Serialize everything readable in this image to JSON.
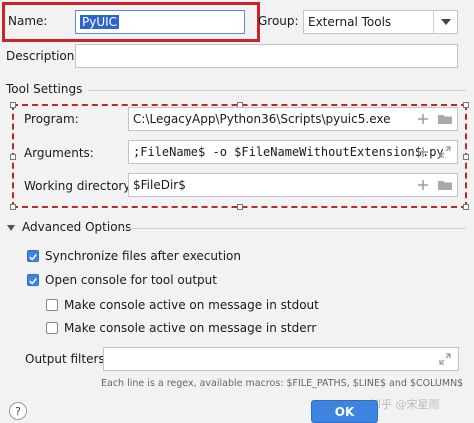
{
  "name": {
    "label": "Name:",
    "value": "PyUIC"
  },
  "group": {
    "label": "Group:",
    "value": "External Tools"
  },
  "description": {
    "label": "Description:",
    "value": ""
  },
  "tool_settings": {
    "title": "Tool Settings",
    "program": {
      "label": "Program:",
      "value": "C:\\LegacyApp\\Python36\\Scripts\\pyuic5.exe"
    },
    "arguments": {
      "label": "Arguments:",
      "value": ";FileName$ -o $FileNameWithoutExtension$.py"
    },
    "working_directory": {
      "label": "Working directory:",
      "value": "$FileDir$"
    }
  },
  "advanced": {
    "title": "Advanced Options",
    "sync_files": {
      "label": "Synchronize files after execution",
      "checked": true
    },
    "open_console": {
      "label": "Open console for tool output",
      "checked": true
    },
    "console_active_stdout": {
      "label": "Make console active on message in stdout",
      "checked": false
    },
    "console_active_stderr": {
      "label": "Make console active on message in stderr",
      "checked": false
    },
    "output_filters": {
      "label": "Output filters:",
      "value": ""
    },
    "hint": "Each line is a regex, available macros: $FILE_PATHS, $LINE$ and $COLUMN$"
  },
  "footer": {
    "help": "?",
    "ok": "OK"
  },
  "watermark": "知乎 @宋星雨",
  "icons": {
    "add": "plus-icon",
    "browse": "folder-icon",
    "expand": "expand-icon",
    "dropdown": "chevron-down-icon",
    "collapse": "triangle-down-icon"
  },
  "colors": {
    "accent": "#3c84e0",
    "highlight_red": "#cc2229",
    "selection": "#2f65ca"
  }
}
